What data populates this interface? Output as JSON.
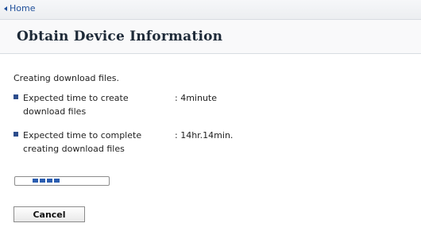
{
  "breadcrumb": {
    "home_label": "Home"
  },
  "page": {
    "title": "Obtain Device Information",
    "intro": "Creating download files."
  },
  "info": [
    {
      "label": "Expected time to create download files",
      "value": ": 4minute"
    },
    {
      "label": "Expected time to complete creating download files",
      "value": ": 14hr.14min."
    }
  ],
  "progress": {
    "indicator": "indeterminate",
    "accent_color": "#2a5db0"
  },
  "actions": {
    "cancel_label": "Cancel"
  },
  "icons": {
    "breadcrumb": "left-arrow-icon",
    "bullet": "square-bullet-icon"
  }
}
